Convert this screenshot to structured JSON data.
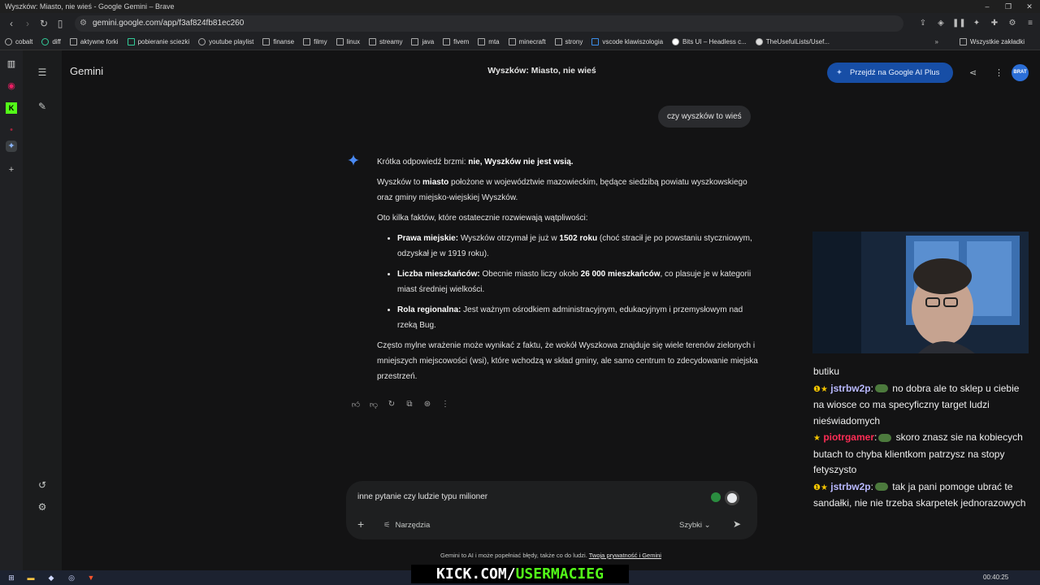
{
  "window": {
    "title": "Wyszków: Miasto, nie wieś - Google Gemini – Brave"
  },
  "browser": {
    "url": "gemini.google.com/app/f3af824fb81ec260",
    "bookmarks": [
      "cobalt",
      "diff",
      "aktywne forki",
      "pobieranie sciezki",
      "youtube playlist",
      "finanse",
      "filmy",
      "linux",
      "streamy",
      "java",
      "fivem",
      "mta",
      "minecraft",
      "strony",
      "vscode klawiszologia",
      "Bits UI – Headless c...",
      "TheUsefulLists/Usef..."
    ],
    "all_bookmarks": "Wszystkie zakładki"
  },
  "gemini": {
    "logo": "Gemini",
    "conversation_title": "Wyszków: Miasto, nie wieś",
    "upgrade_label": "Przejdź na Google AI Plus",
    "avatar_text": "BRAT",
    "user_prompt": "czy wyszków to wieś",
    "answer": {
      "intro_pre": "Krótka odpowiedź brzmi: ",
      "intro_bold": "nie, Wyszków nie jest wsią.",
      "p1_a": "Wyszków to ",
      "p1_b": "miasto",
      "p1_c": " położone w województwie mazowieckim, będące siedzibą powiatu wyszkowskiego oraz gminy miejsko-wiejskiej Wyszków.",
      "facts_intro": "Oto kilka faktów, które ostatecznie rozwiewają wątpliwości:",
      "b1_label": "Prawa miejskie:",
      "b1_a": " Wyszków otrzymał je już w ",
      "b1_b": "1502 roku",
      "b1_c": " (choć stracił je po powstaniu styczniowym, odzyskał je w 1919 roku).",
      "b2_label": "Liczba mieszkańców:",
      "b2_a": " Obecnie miasto liczy około ",
      "b2_b": "26 000 mieszkańców",
      "b2_c": ", co plasuje je w kategorii miast średniej wielkości.",
      "b3_label": "Rola regionalna:",
      "b3_a": " Jest ważnym ośrodkiem administracyjnym, edukacyjnym i przemysłowym nad rzeką Bug.",
      "closing": "Często mylne wrażenie może wynikać z faktu, że wokół Wyszkowa znajduje się wiele terenów zielonych i mniejszych miejscowości (wsi), które wchodzą w skład gminy, ale samo centrum to zdecydowanie miejska przestrzeń."
    },
    "composer": {
      "text": "inne pytanie czy ludzie typu milioner",
      "tools_label": "Narzędzia",
      "mode_label": "Szybki"
    },
    "disclaimer_a": "Gemini to AI i może popełniać błędy, także co do ludzi. ",
    "disclaimer_link": "Twoja prywatność i Gemini"
  },
  "stream_chat": {
    "top_line": "butiku",
    "messages": [
      {
        "user": "jstrbw2p",
        "text": " no dobra ale to sklep u ciebie na wiosce co ma specyficzny target ludzi nieświadomych"
      },
      {
        "user": "piotrgamer",
        "text": " skoro znasz sie na kobiecych butach to chyba klientkom patrzysz na stopy fetyszysto"
      },
      {
        "user": "jstrbw2p",
        "text": " tak ja pani pomoge ubrać te sandałki, nie nie trzeba skarpetek jednorazowych"
      }
    ]
  },
  "overlay": {
    "kick_white": "KICK.COM/",
    "kick_green": "USERMACIEG"
  },
  "taskbar": {
    "clock": "00:40:25"
  }
}
